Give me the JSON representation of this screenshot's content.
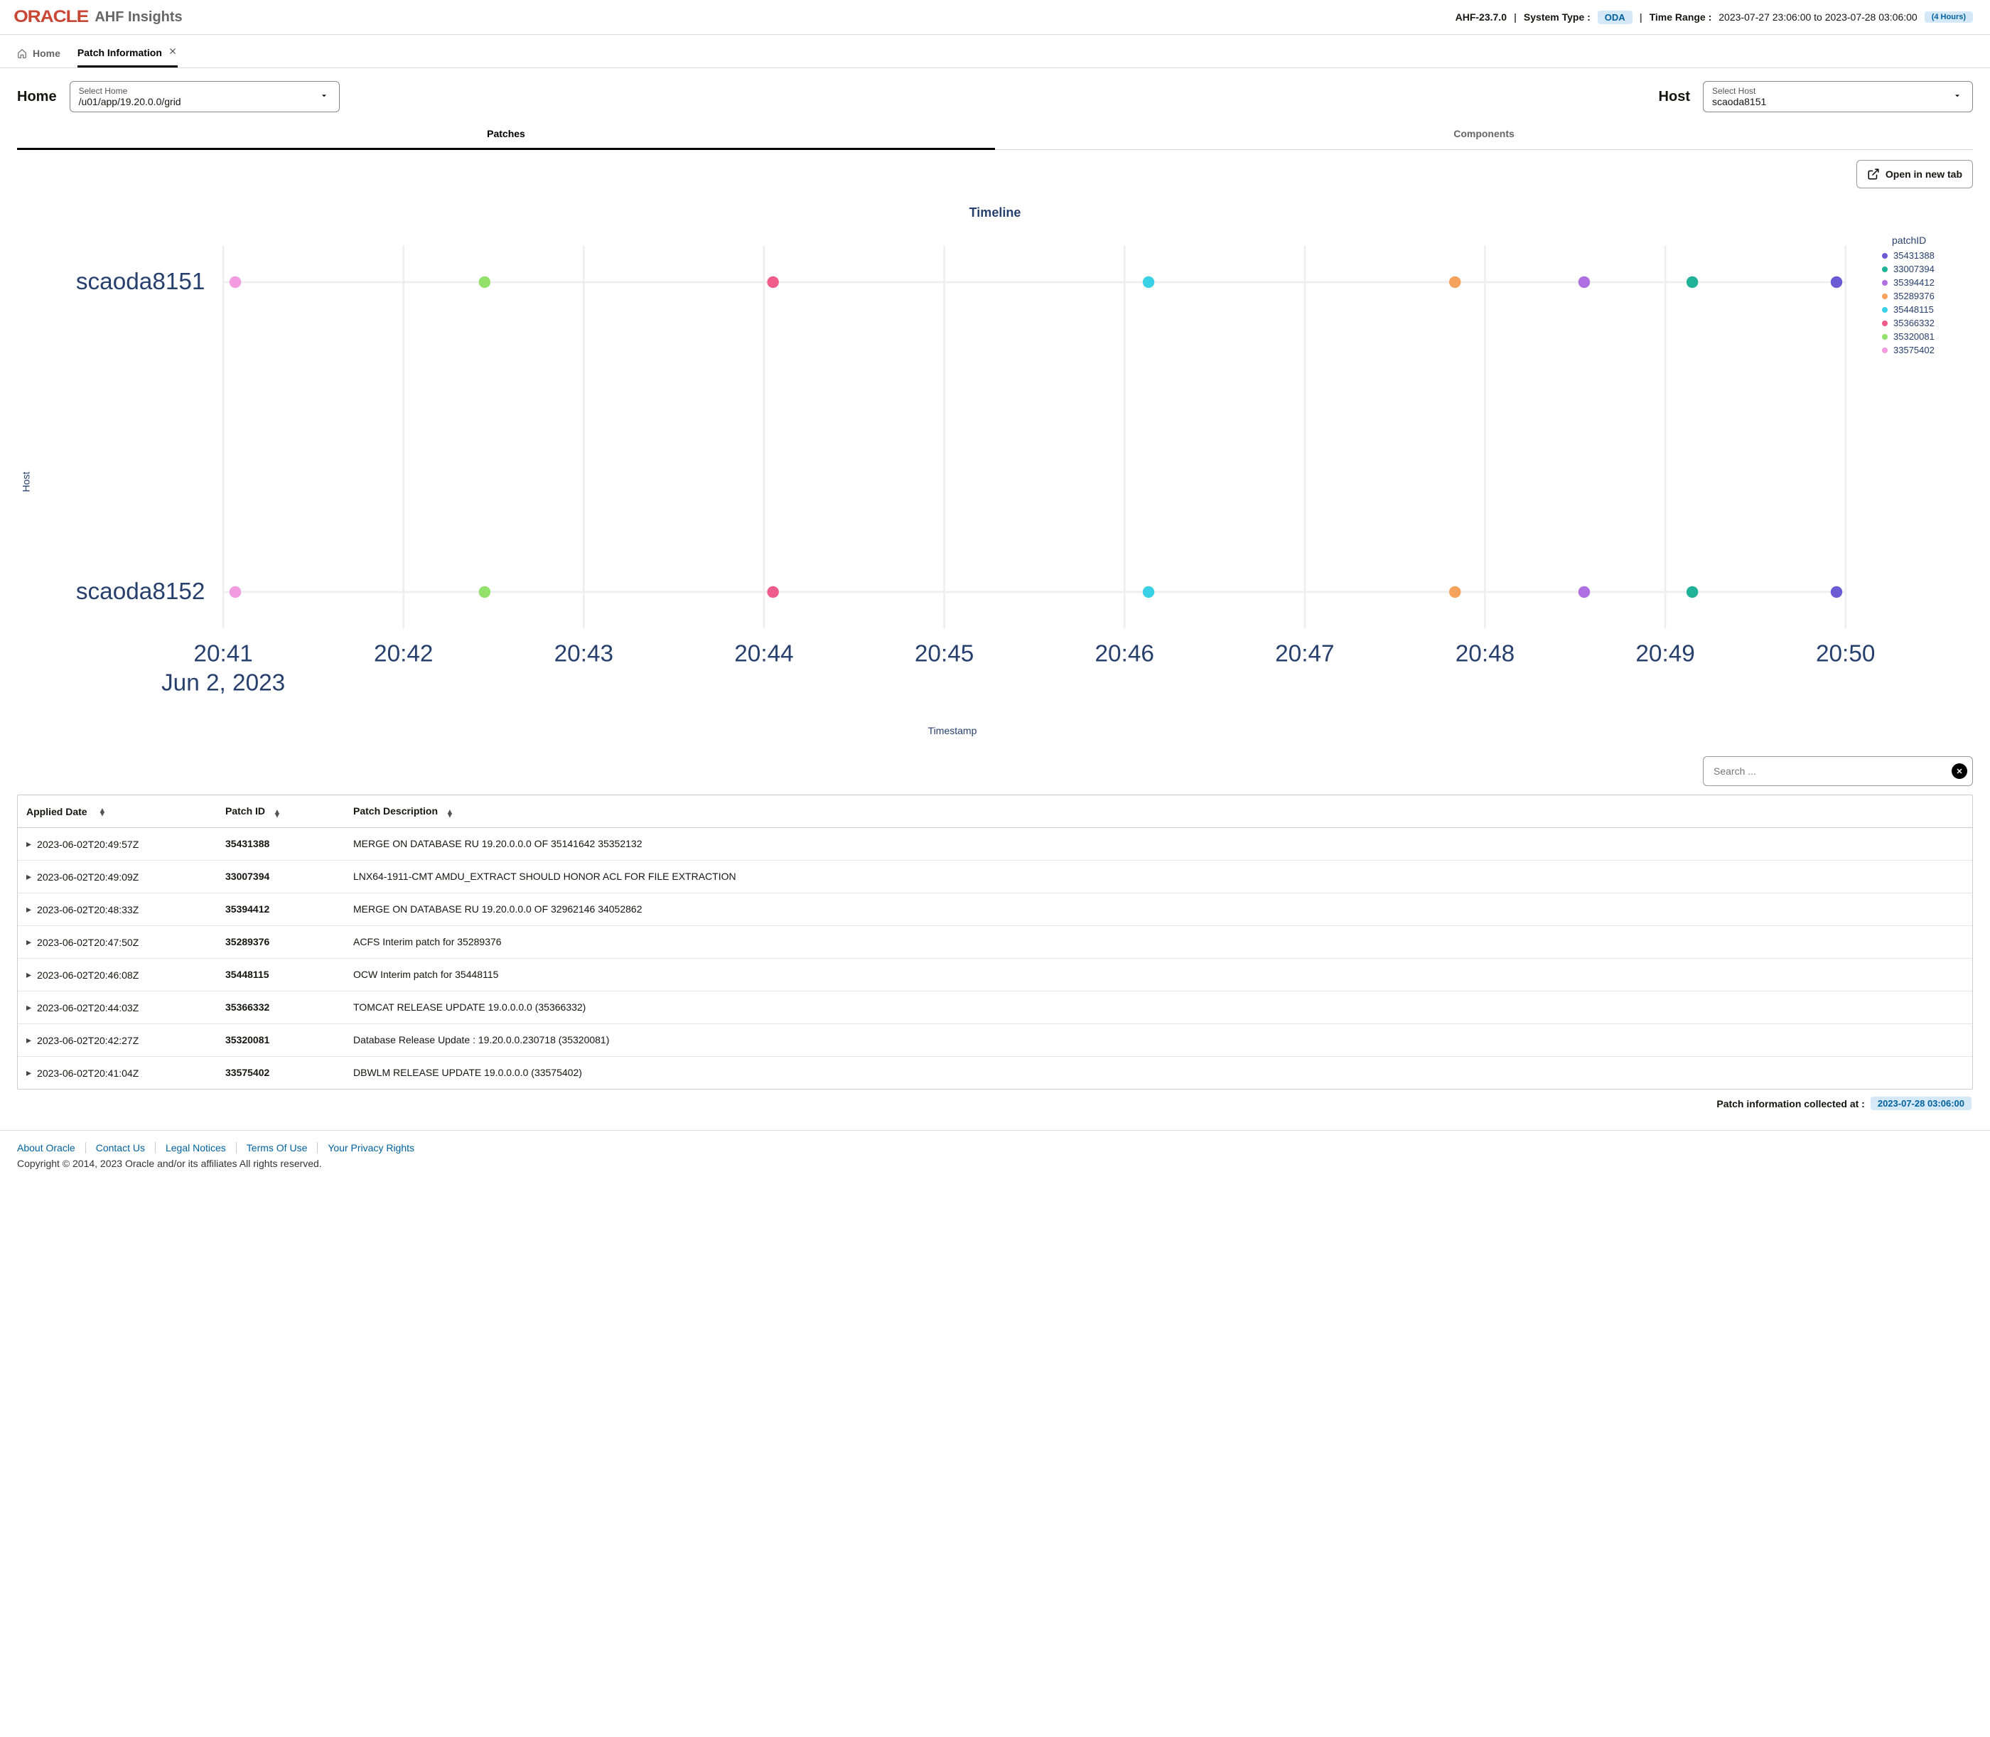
{
  "header": {
    "logo": "ORACLE",
    "app_title": "AHF Insights",
    "version": "AHF-23.7.0",
    "system_type_label": "System Type :",
    "system_type_value": "ODA",
    "time_range_label": "Time Range :",
    "time_range_value": "2023-07-27 23:06:00 to 2023-07-28 03:06:00",
    "duration_badge": "(4 Hours)"
  },
  "subnav": {
    "home_label": "Home",
    "active_tab_label": "Patch Information"
  },
  "selectors": {
    "home_label": "Home",
    "home_field_label": "Select Home",
    "home_value": "/u01/app/19.20.0.0/grid",
    "host_label": "Host",
    "host_field_label": "Select Host",
    "host_value": "scaoda8151"
  },
  "inner_tabs": {
    "patches": "Patches",
    "components": "Components"
  },
  "open_btn_label": "Open in new tab",
  "chart_data": {
    "type": "scatter",
    "title": "Timeline",
    "xlabel": "Timestamp",
    "ylabel": "Host",
    "legend_title": "patchID",
    "y_categories": [
      "scaoda8151",
      "scaoda8152"
    ],
    "x_ticks": [
      "20:41",
      "20:42",
      "20:43",
      "20:44",
      "20:45",
      "20:46",
      "20:47",
      "20:48",
      "20:49",
      "20:50"
    ],
    "x_sub_label": "Jun 2, 2023",
    "series": [
      {
        "name": "35431388",
        "color": "#6b5cd6",
        "points": [
          {
            "x": "20:49:57",
            "y": "scaoda8151"
          },
          {
            "x": "20:49:57",
            "y": "scaoda8152"
          }
        ]
      },
      {
        "name": "33007394",
        "color": "#1fb298",
        "points": [
          {
            "x": "20:49:09",
            "y": "scaoda8151"
          },
          {
            "x": "20:49:09",
            "y": "scaoda8152"
          }
        ]
      },
      {
        "name": "35394412",
        "color": "#b06fe0",
        "points": [
          {
            "x": "20:48:33",
            "y": "scaoda8151"
          },
          {
            "x": "20:48:33",
            "y": "scaoda8152"
          }
        ]
      },
      {
        "name": "35289376",
        "color": "#f5a25d",
        "points": [
          {
            "x": "20:47:50",
            "y": "scaoda8151"
          },
          {
            "x": "20:47:50",
            "y": "scaoda8152"
          }
        ]
      },
      {
        "name": "35448115",
        "color": "#3ad0e6",
        "points": [
          {
            "x": "20:46:08",
            "y": "scaoda8151"
          },
          {
            "x": "20:46:08",
            "y": "scaoda8152"
          }
        ]
      },
      {
        "name": "35366332",
        "color": "#ef5b8a",
        "points": [
          {
            "x": "20:44:03",
            "y": "scaoda8151"
          },
          {
            "x": "20:44:03",
            "y": "scaoda8152"
          }
        ]
      },
      {
        "name": "35320081",
        "color": "#93e06b",
        "points": [
          {
            "x": "20:42:27",
            "y": "scaoda8151"
          },
          {
            "x": "20:42:27",
            "y": "scaoda8152"
          }
        ]
      },
      {
        "name": "33575402",
        "color": "#f29be0",
        "points": [
          {
            "x": "20:41:04",
            "y": "scaoda8151"
          },
          {
            "x": "20:41:04",
            "y": "scaoda8152"
          }
        ]
      }
    ]
  },
  "search": {
    "placeholder": "Search ..."
  },
  "table": {
    "columns": {
      "date": "Applied Date",
      "pid": "Patch ID",
      "desc": "Patch Description"
    },
    "rows": [
      {
        "date": "2023-06-02T20:49:57Z",
        "pid": "35431388",
        "desc": "MERGE ON DATABASE RU 19.20.0.0.0 OF 35141642 35352132"
      },
      {
        "date": "2023-06-02T20:49:09Z",
        "pid": "33007394",
        "desc": "LNX64-1911-CMT AMDU_EXTRACT SHOULD HONOR ACL FOR FILE EXTRACTION"
      },
      {
        "date": "2023-06-02T20:48:33Z",
        "pid": "35394412",
        "desc": "MERGE ON DATABASE RU 19.20.0.0.0 OF 32962146 34052862"
      },
      {
        "date": "2023-06-02T20:47:50Z",
        "pid": "35289376",
        "desc": "ACFS Interim patch for 35289376"
      },
      {
        "date": "2023-06-02T20:46:08Z",
        "pid": "35448115",
        "desc": "OCW Interim patch for 35448115"
      },
      {
        "date": "2023-06-02T20:44:03Z",
        "pid": "35366332",
        "desc": "TOMCAT RELEASE UPDATE 19.0.0.0.0 (35366332)"
      },
      {
        "date": "2023-06-02T20:42:27Z",
        "pid": "35320081",
        "desc": "Database Release Update : 19.20.0.0.230718 (35320081)"
      },
      {
        "date": "2023-06-02T20:41:04Z",
        "pid": "33575402",
        "desc": "DBWLM RELEASE UPDATE 19.0.0.0.0 (33575402)"
      }
    ]
  },
  "footnote": {
    "label": "Patch information collected at :",
    "value": "2023-07-28 03:06:00"
  },
  "footer": {
    "links": [
      "About Oracle",
      "Contact Us",
      "Legal Notices",
      "Terms Of Use",
      "Your Privacy Rights"
    ],
    "copyright": "Copyright © 2014, 2023 Oracle and/or its affiliates All rights reserved."
  }
}
